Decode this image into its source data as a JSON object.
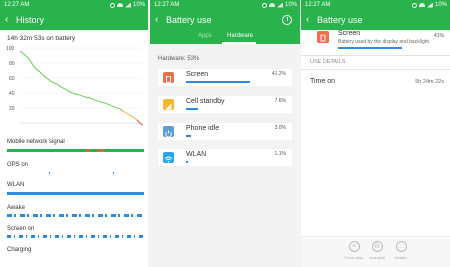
{
  "status_bar": {
    "time": "12:27 AM",
    "battery": "10%"
  },
  "history": {
    "title": "History",
    "duration": "14h 32m 53s on battery",
    "y_ticks": [
      "100",
      "80",
      "60",
      "40",
      "20"
    ],
    "tracks": [
      {
        "label": "Mobile network signal"
      },
      {
        "label": "GPS on"
      },
      {
        "label": "WLAN"
      },
      {
        "label": "Awake"
      },
      {
        "label": "Screen on"
      },
      {
        "label": "Charging"
      }
    ]
  },
  "battery_use": {
    "title": "Battery use",
    "tabs": [
      "Apps",
      "Hardware"
    ],
    "active_tab": "Hardware",
    "hardware_total": "Hardware: 53%",
    "items": [
      {
        "name": "Screen",
        "percent": "41.2%",
        "value": 41.2,
        "icon": "screen-icon",
        "color": "#f46b50"
      },
      {
        "name": "Cell standby",
        "percent": "7.6%",
        "value": 7.6,
        "icon": "signal-icon",
        "color": "#f7b731"
      },
      {
        "name": "Phone idle",
        "percent": "3.0%",
        "value": 3.0,
        "icon": "power-icon",
        "color": "#5f9bd8"
      },
      {
        "name": "WLAN",
        "percent": "1.1%",
        "value": 1.1,
        "icon": "wifi-icon",
        "color": "#2ba4f0"
      }
    ]
  },
  "detail": {
    "title": "Battery use",
    "name": "Screen",
    "percent": "41%",
    "value": 41,
    "subtitle": "Battery used by the display and backlight",
    "section_header": "USE DETAILS",
    "rows": [
      {
        "label": "Time on",
        "value": "5h 24m 22s"
      }
    ],
    "actions": [
      "Force stop",
      "Uninstall",
      "Details"
    ]
  },
  "colors": {
    "accent": "#2ab24d",
    "bar": "#2f8ce3",
    "graph_line": "#5ac840",
    "graph_low": "#f2b21a",
    "graph_critical": "#e4432d"
  }
}
